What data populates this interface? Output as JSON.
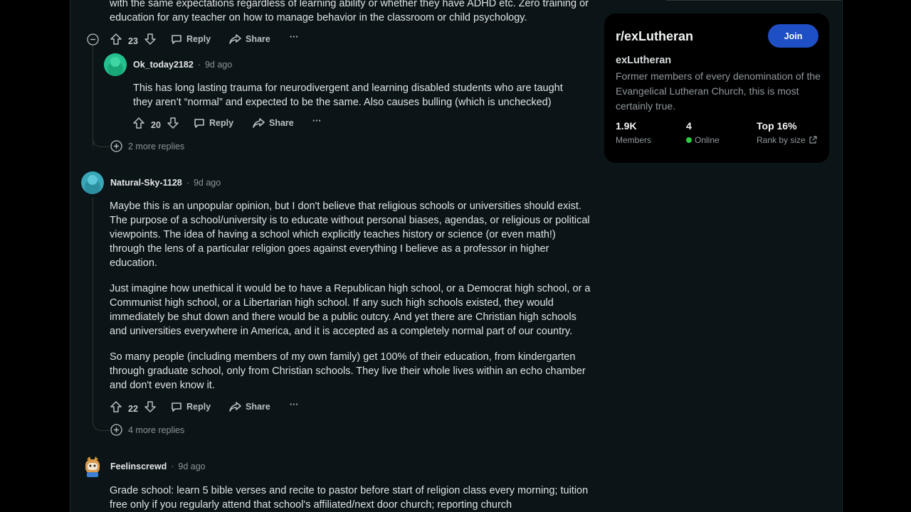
{
  "comments": [
    {
      "body_partial": "with the same expectations regardless of learning ability or whether they have ADHD etc. Zero training or education for any teacher on how to manage behavior in the classroom or child psychology.",
      "votes": "23",
      "reply": "Reply",
      "share": "Share",
      "more_actions": "···"
    },
    {
      "username": "Ok_today2182",
      "time": "9d ago",
      "body": "This has long lasting trauma for neurodivergent and learning disabled students who are taught they aren’t “normal” and expected to be the same. Also causes bulling (which is unchecked)",
      "votes": "20",
      "reply": "Reply",
      "share": "Share",
      "more_actions": "···",
      "more_replies": "2 more replies"
    },
    {
      "username": "Natural-Sky-1128",
      "time": "9d ago",
      "paragraphs": [
        "Maybe this is an unpopular opinion, but I don't believe that religious schools or universities should exist. The purpose of a school/university is to educate without personal biases, agendas, or religious or political viewpoints. The idea of having a school which explicitly teaches history or science (or even math!) through the lens of a particular religion goes against everything I believe as a professor in higher education.",
        "Just imagine how unethical it would be to have a Republican high school, or a Democrat high school, or a Communist high school, or a Libertarian high school. If any such high schools existed, they would immediately be shut down and there would be a public outcry. And yet there are Christian high schools and universities everywhere in America, and it is accepted as a completely normal part of our country.",
        "So many people (including members of my own family) get 100% of their education, from kindergarten through graduate school, only from Christian schools. They live their whole lives within an echo chamber and don't even know it."
      ],
      "votes": "22",
      "reply": "Reply",
      "share": "Share",
      "more_actions": "···",
      "more_replies": "4 more replies"
    },
    {
      "username": "Feelinscrewd",
      "time": "9d ago",
      "body_partial": "Grade school: learn 5 bible verses and recite to pastor before start of religion class every morning; tuition free only if you regularly attend that school's affiliated/next door church; reporting church"
    }
  ],
  "sidebar": {
    "title": "r/exLutheran",
    "join": "Join",
    "name": "exLutheran",
    "description": "Former members of every denomination of the Evangelical Lutheran Church, this is most certainly true.",
    "stats": [
      {
        "value": "1.9K",
        "label": "Members"
      },
      {
        "value": "4",
        "label": "Online"
      },
      {
        "value": "Top 16%",
        "label": "Rank by size"
      }
    ]
  },
  "colors": {
    "background": "#0b1416",
    "join_button": "#1f4fc4",
    "online_dot": "#2ecc40"
  }
}
